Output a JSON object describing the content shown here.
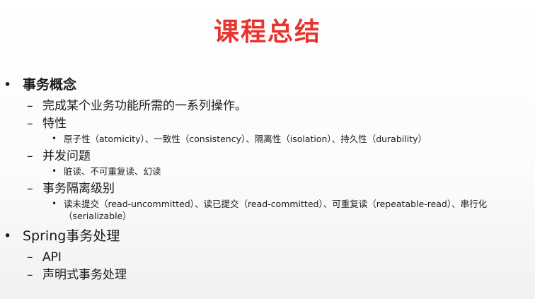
{
  "slide": {
    "title": "课程总结",
    "sections": [
      {
        "heading": "事务概念",
        "bullet": "•",
        "items": [
          {
            "dash": "–",
            "text": "完成某个业务功能所需的一系列操作。"
          },
          {
            "dash": "–",
            "text": "特性",
            "sub": {
              "dot": "•",
              "text": "原子性（atomicity）、一致性（consistency）、隔离性（isolation）、持久性（durability）"
            }
          },
          {
            "dash": "–",
            "text": "并发问题",
            "sub": {
              "dot": "•",
              "text": "脏读、不可重复读、幻读"
            }
          },
          {
            "dash": "–",
            "text": "事务隔离级别",
            "sub": {
              "dot": "•",
              "text": "读未提交（read-uncommitted）、读已提交（read-committed）、可重复读（repeatable-read）、串行化（serializable）"
            }
          }
        ]
      },
      {
        "heading": "Spring事务处理",
        "bullet": "•",
        "items": [
          {
            "dash": "–",
            "text": "API"
          },
          {
            "dash": "–",
            "text": "声明式事务处理"
          }
        ]
      }
    ]
  }
}
